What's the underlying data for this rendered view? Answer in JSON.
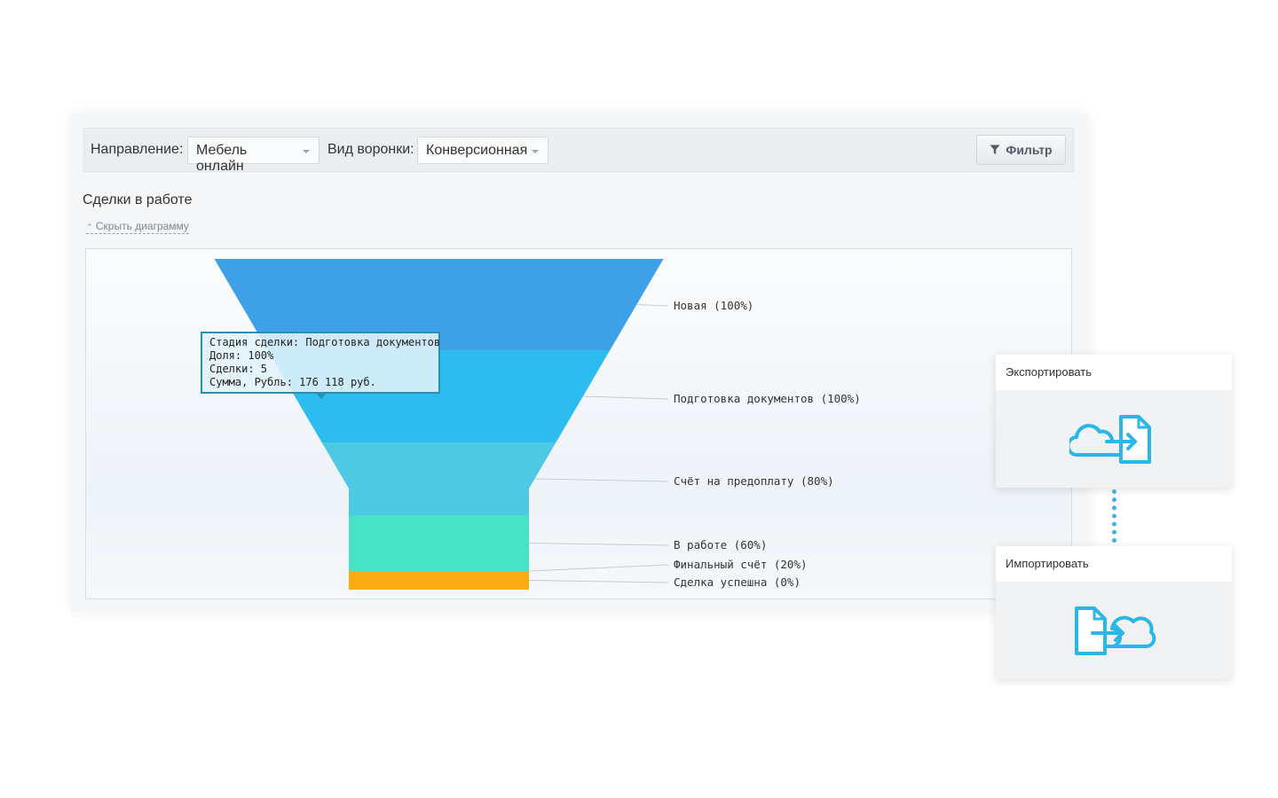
{
  "toolbar": {
    "direction_label": "Направление:",
    "direction_value": "Мебель онлайн",
    "funnel_type_label": "Вид воронки:",
    "funnel_type_value": "Конверсионная",
    "filter_button": "Фильтр"
  },
  "section": {
    "title": "Сделки в работе",
    "hide_chart_link": "Скрыть диаграмму"
  },
  "tooltip": {
    "line1": "Стадия сделки: Подготовка документов",
    "line2": "Доля: 100%",
    "line3": "Сделки: 5",
    "line4": "Сумма, Рубль: 176 118 руб."
  },
  "chart_data": {
    "type": "funnel",
    "stages": [
      {
        "label": "Новая (100%)",
        "name": "Новая",
        "percent": 100,
        "color": "#3ea0e6"
      },
      {
        "label": "Подготовка документов (100%)",
        "name": "Подготовка документов",
        "percent": 100,
        "color": "#2cbcf0"
      },
      {
        "label": "Счёт на предоплату (80%)",
        "name": "Счёт на предоплату",
        "percent": 80,
        "color": "#4ec9e3"
      },
      {
        "label": "В работе (60%)",
        "name": "В работе",
        "percent": 60,
        "color": "#46e2c6"
      },
      {
        "label": "Финальный счёт (20%)",
        "name": "Финальный счёт",
        "percent": 20,
        "color": "#46e2c6"
      },
      {
        "label": "Сделка успешна (0%)",
        "name": "Сделка успешна",
        "percent": 0,
        "color": "#f8ab13"
      }
    ]
  },
  "cards": {
    "export_title": "Экспортировать",
    "import_title": "Импортировать"
  },
  "colors": {
    "accent_icon": "#29b6e8",
    "connector": "#45aee4"
  }
}
